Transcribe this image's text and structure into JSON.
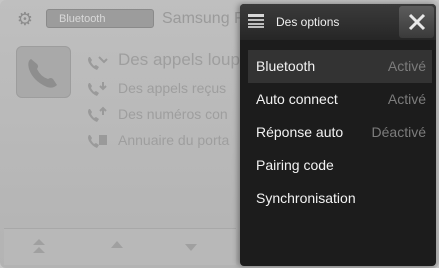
{
  "background": {
    "bluetooth_tab": "Bluetooth",
    "device_name": "Samsung F",
    "items": [
      {
        "label": "Des appels loup",
        "icon": "phone-missed-icon"
      },
      {
        "label": "Des appels reçus",
        "icon": "phone-incoming-icon"
      },
      {
        "label": "Des numéros con",
        "icon": "phone-outgoing-icon"
      },
      {
        "label": "Annuaire du porta",
        "icon": "phonebook-icon"
      }
    ]
  },
  "menu": {
    "title": "Des options",
    "items": [
      {
        "label": "Bluetooth",
        "value": "Activé"
      },
      {
        "label": "Auto connect",
        "value": "Activé"
      },
      {
        "label": "Réponse auto",
        "value": "Déactivé"
      },
      {
        "label": "Pairing code",
        "value": ""
      },
      {
        "label": "Synchronisation",
        "value": ""
      }
    ]
  },
  "colors": {
    "menu_bg": "#1c1c1c",
    "menu_text": "#f2f2f2",
    "menu_value_text": "#7c7c7c",
    "background_screen": "#bfbfbf"
  }
}
